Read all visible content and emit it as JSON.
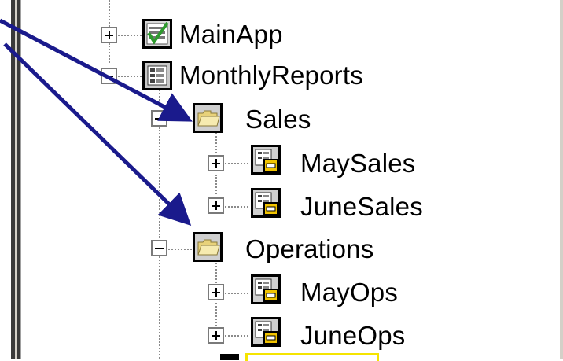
{
  "tree": {
    "items": [
      {
        "label": "MainApp",
        "icon": "checked-form-icon",
        "expander": "plus"
      },
      {
        "label": "MonthlyReports",
        "icon": "report-group-icon",
        "expander": "minus"
      },
      {
        "label": "Sales",
        "icon": "folder-icon",
        "expander": "minus"
      },
      {
        "label": "MaySales",
        "icon": "report-icon",
        "expander": "plus"
      },
      {
        "label": "JuneSales",
        "icon": "report-icon",
        "expander": "plus"
      },
      {
        "label": "Operations",
        "icon": "folder-icon",
        "expander": "minus"
      },
      {
        "label": "MayOps",
        "icon": "report-icon",
        "expander": "plus"
      },
      {
        "label": "JuneOps",
        "icon": "report-icon",
        "expander": "plus"
      }
    ]
  },
  "colors": {
    "arrow": "#1a1a8c",
    "highlight": "#f5e400",
    "folder": "#f2e39a",
    "report_accent": "#e8b800"
  }
}
